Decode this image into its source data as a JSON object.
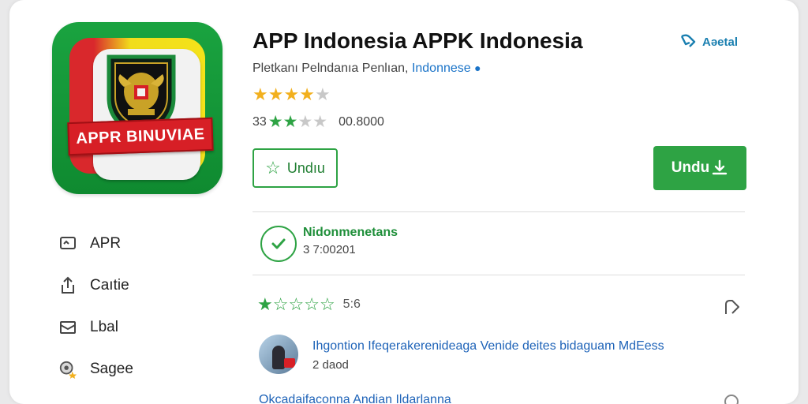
{
  "app": {
    "title": "APP Indonesia APPK Indonesia",
    "subtitle_prefix": "Pletkanı Pelndanıa Penlıan,",
    "developer": "Indonnese",
    "icon_banner": "APPR BINUVIAE"
  },
  "share": {
    "label": "Aəetal"
  },
  "rating": {
    "stars_filled": 4,
    "stars_total": 5,
    "row2_prefix": "33",
    "row2_stars_filled": 2,
    "row2_text": "00.8000"
  },
  "buttons": {
    "wishlist_label": "Undıu",
    "install_label": "Undu"
  },
  "sidebar": {
    "items": [
      {
        "label": "APR",
        "icon": "message-icon"
      },
      {
        "label": "Caıtie",
        "icon": "share-icon"
      },
      {
        "label": "Lbal",
        "icon": "mail-icon"
      },
      {
        "label": "Sagee",
        "icon": "badge-icon"
      }
    ]
  },
  "verified": {
    "title": "Nidonmenetans",
    "subtitle": "3 7:00201"
  },
  "reviews_summary": {
    "count_text": "5:6",
    "stars_filled": 1
  },
  "reviews": [
    {
      "text": "Ihgontion Ifeqerakerenideaga Venide deites bidaguam MdEess",
      "meta": "2 daod"
    },
    {
      "text": "Okcadaifaconna Andian Ildarlanna"
    }
  ],
  "colors": {
    "accent_green": "#2ea344",
    "link_blue": "#1e63b8",
    "star_gold": "#f2b01e",
    "star_empty": "#c8c8c8"
  }
}
